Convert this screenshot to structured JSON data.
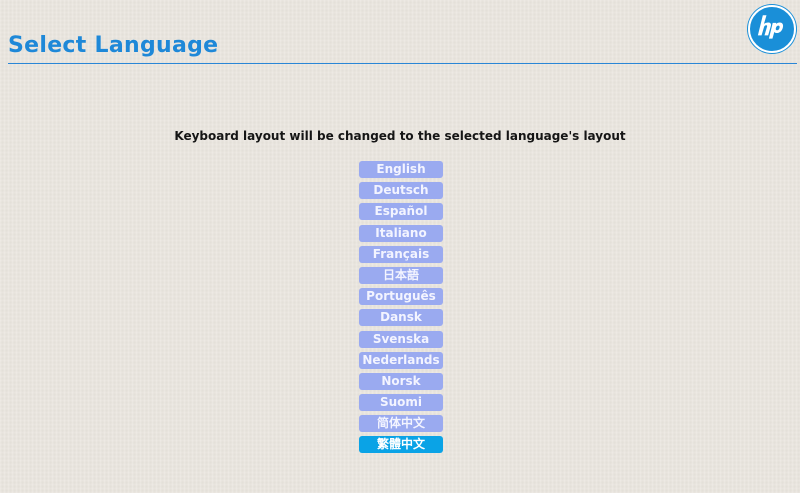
{
  "header": {
    "title": "Select Language",
    "logo_text": "hp"
  },
  "instruction": "Keyboard layout will be changed to the selected language's layout",
  "languages": [
    {
      "label": "English",
      "selected": false
    },
    {
      "label": "Deutsch",
      "selected": false
    },
    {
      "label": "Español",
      "selected": false
    },
    {
      "label": "Italiano",
      "selected": false
    },
    {
      "label": "Français",
      "selected": false
    },
    {
      "label": "日本語",
      "selected": false
    },
    {
      "label": "Português",
      "selected": false
    },
    {
      "label": "Dansk",
      "selected": false
    },
    {
      "label": "Svenska",
      "selected": false
    },
    {
      "label": "Nederlands",
      "selected": false
    },
    {
      "label": "Norsk",
      "selected": false
    },
    {
      "label": "Suomi",
      "selected": false
    },
    {
      "label": "简体中文",
      "selected": false
    },
    {
      "label": "繁體中文",
      "selected": true
    }
  ],
  "colors": {
    "accent": "#1e88d8",
    "button": "#9aaaf0",
    "button_selected": "#0aa3e6",
    "background": "#eae6df"
  }
}
